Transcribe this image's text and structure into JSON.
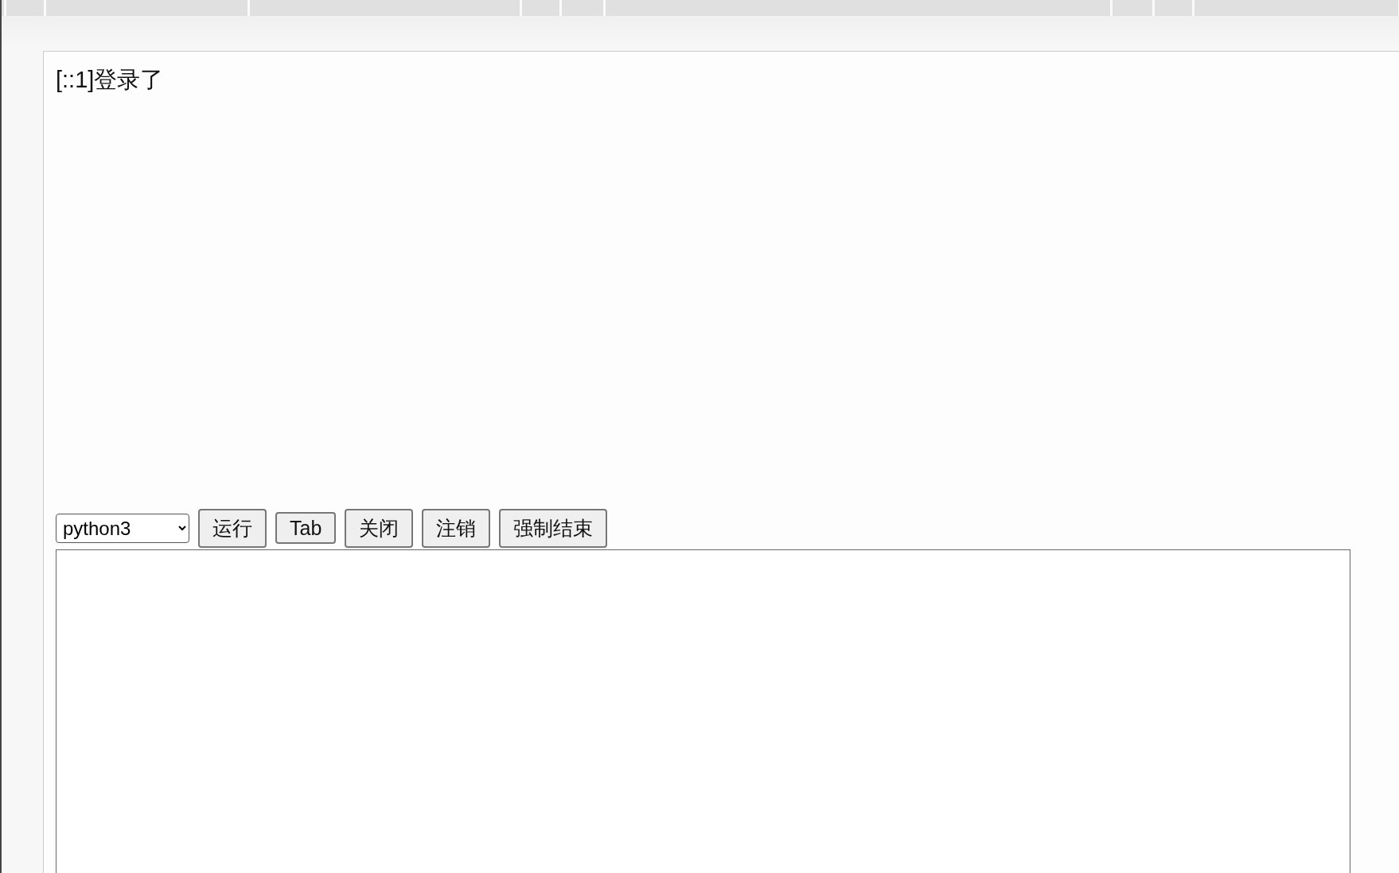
{
  "message": "[::1]登录了",
  "language_select": {
    "value": "python3"
  },
  "buttons": [
    "运行",
    "Tab",
    "关闭",
    "注销",
    "强制结束"
  ]
}
